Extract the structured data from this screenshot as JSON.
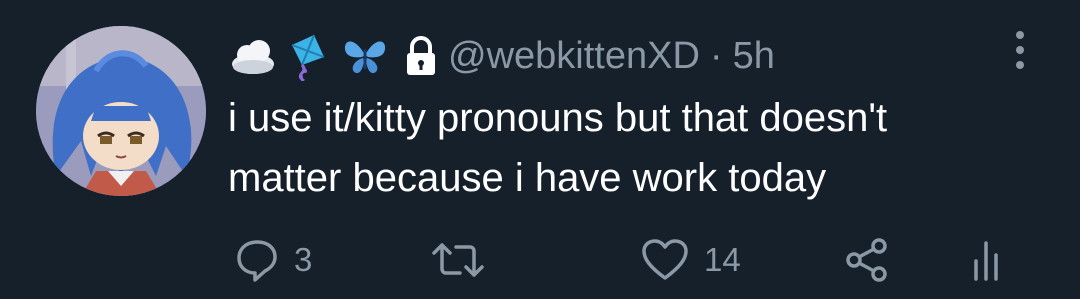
{
  "tweet": {
    "display_name_emojis": [
      "cloud-icon",
      "kite-icon",
      "butterfly-icon"
    ],
    "protected_icon": "lock-icon",
    "handle": "@webkittenXD",
    "separator": "·",
    "time": "5h",
    "text_line1": "i use it/kitty pronouns but that doesn't",
    "text_line2": "matter because i have work today"
  },
  "actions": {
    "reply_count": "3",
    "like_count": "14"
  },
  "colors": {
    "background": "#15202b",
    "text": "#ffffff",
    "secondary": "#8b98a5",
    "kite": "#3bb3e6",
    "butterfly": "#5aa7e8"
  }
}
